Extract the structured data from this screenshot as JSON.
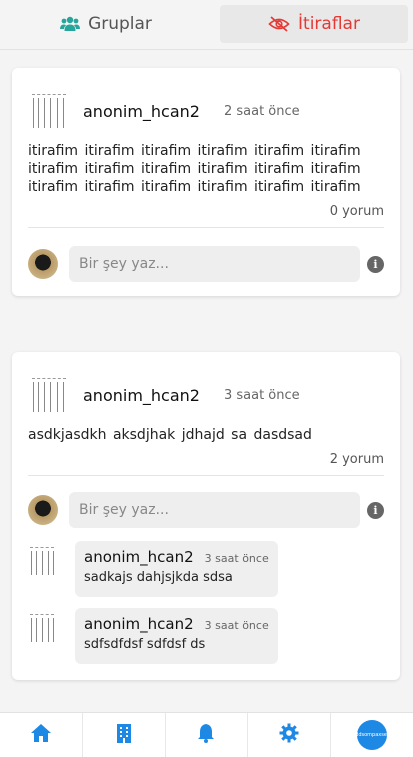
{
  "tabs": {
    "groups_label": "Gruplar",
    "confessions_label": "İtiraflar"
  },
  "colors": {
    "accent_teal": "#26a69a",
    "accent_red": "#e53935",
    "nav_blue": "#1e88e5"
  },
  "icons": {
    "groups": "users-icon",
    "confessions": "eye-slash-icon",
    "home": "home-icon",
    "building": "building-icon",
    "bell": "bell-icon",
    "settings": "gear-icon",
    "info": "info-icon"
  },
  "posts": [
    {
      "username": "anonim_hcan2",
      "time": "2 saat önce",
      "text": "itirafim itirafim itirafim itirafim itirafim itirafim itirafim itirafim itirafim itirafim itirafim itirafim itirafim itirafim itirafim itirafim itirafim itirafim",
      "comment_count": "0 yorum",
      "reply_placeholder": "Bir şey yaz...",
      "comments": []
    },
    {
      "username": "anonim_hcan2",
      "time": "3 saat önce",
      "text": "asdkjasdkh aksdjhak jdhajd sa dasdsad",
      "comment_count": "2 yorum",
      "reply_placeholder": "Bir şey yaz...",
      "comments": [
        {
          "username": "anonim_hcan2",
          "time": "3 saat önce",
          "text": "sadkajs dahjsjkda sdsa"
        },
        {
          "username": "anonim_hcan2",
          "time": "3 saat önce",
          "text": "sdfsdfdsf sdfdsf ds"
        }
      ]
    }
  ],
  "bottom_nav": {
    "profile_text": "ddsompaxser"
  }
}
